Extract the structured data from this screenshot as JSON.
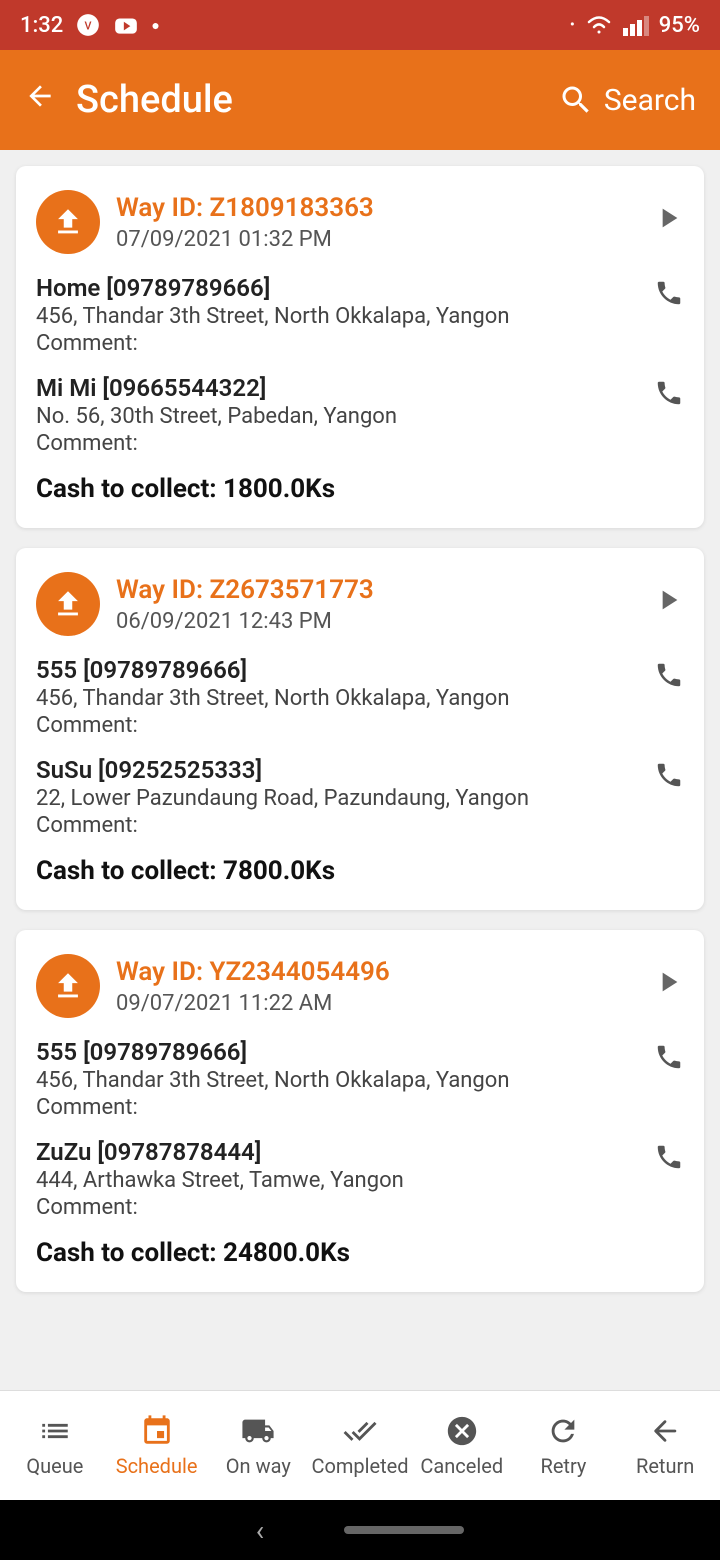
{
  "statusBar": {
    "time": "1:32",
    "battery": "95%"
  },
  "header": {
    "title": "Schedule",
    "searchLabel": "Search"
  },
  "cards": [
    {
      "wayId": "Way ID: Z1809183363",
      "date": "07/09/2021 01:32 PM",
      "addresses": [
        {
          "name": "Home [09789789666]",
          "street": "456, Thandar 3th Street, North Okkalapa, Yangon",
          "comment": "Comment:"
        },
        {
          "name": "Mi Mi [09665544322]",
          "street": "No. 56, 30th Street, Pabedan, Yangon",
          "comment": "Comment:"
        }
      ],
      "cashToCollect": "Cash to collect: 1800.0Ks"
    },
    {
      "wayId": "Way ID: Z2673571773",
      "date": "06/09/2021 12:43 PM",
      "addresses": [
        {
          "name": "555 [09789789666]",
          "street": "456, Thandar 3th Street, North Okkalapa, Yangon",
          "comment": "Comment:"
        },
        {
          "name": "SuSu [09252525333]",
          "street": "22, Lower Pazundaung Road, Pazundaung, Yangon",
          "comment": "Comment:"
        }
      ],
      "cashToCollect": "Cash to collect: 7800.0Ks"
    },
    {
      "wayId": "Way ID: YZ2344054496",
      "date": "09/07/2021 11:22 AM",
      "addresses": [
        {
          "name": "555 [09789789666]",
          "street": "456, Thandar 3th Street, North Okkalapa, Yangon",
          "comment": "Comment:"
        },
        {
          "name": "ZuZu [09787878444]",
          "street": "444, Arthawka Street, Tamwe, Yangon",
          "comment": "Comment:"
        }
      ],
      "cashToCollect": "Cash to collect: 24800.0Ks"
    }
  ],
  "bottomNav": [
    {
      "id": "queue",
      "label": "Queue",
      "active": false
    },
    {
      "id": "schedule",
      "label": "Schedule",
      "active": true
    },
    {
      "id": "onway",
      "label": "On way",
      "active": false
    },
    {
      "id": "completed",
      "label": "Completed",
      "active": false
    },
    {
      "id": "canceled",
      "label": "Canceled",
      "active": false
    },
    {
      "id": "retry",
      "label": "Retry",
      "active": false
    },
    {
      "id": "return",
      "label": "Return",
      "active": false
    }
  ]
}
